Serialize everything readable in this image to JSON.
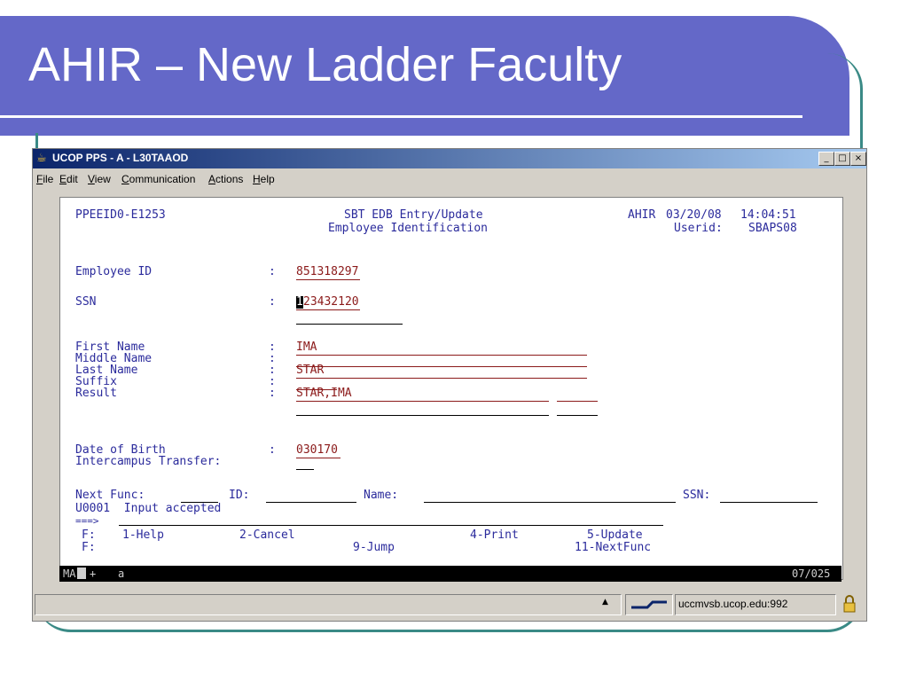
{
  "slide": {
    "title": "AHIR – New Ladder Faculty"
  },
  "window": {
    "title": "UCOP PPS - A - L30TAAOD",
    "controls": {
      "minimize": "_",
      "maximize": "□",
      "close": "×"
    },
    "menu": [
      "File",
      "Edit",
      "View",
      "Communication",
      "Actions",
      "Help"
    ]
  },
  "screen": {
    "program_id": "PPEEID0-E1253",
    "heading1": "SBT EDB Entry/Update",
    "heading2": "Employee Identification",
    "system": "AHIR",
    "date": "03/20/08",
    "time": "14:04:51",
    "userid_label": "Userid:",
    "userid": "SBAPS08",
    "fields": {
      "employee_id_label": "Employee ID",
      "employee_id": "851318297",
      "ssn_label": "SSN",
      "ssn_first": "1",
      "ssn_rest": "23432120",
      "first_name_label": "First Name",
      "first_name": "IMA",
      "middle_name_label": "Middle Name",
      "last_name_label": "Last Name",
      "last_name": "STAR",
      "suffix_label": "Suffix",
      "result_label": "Result",
      "result": "STAR,IMA",
      "dob_label": "Date of Birth",
      "dob": "030170",
      "intercampus_label": "Intercampus Transfer:",
      "colon": ":"
    },
    "nav": {
      "next_func": "Next Func:",
      "id": "ID:",
      "name": "Name:",
      "ssn": "SSN:"
    },
    "message": "U0001  Input accepted",
    "prompt": "===>",
    "fkeys_row1": {
      "label": "F:",
      "f1": "1-Help",
      "f2": "2-Cancel",
      "f4": "4-Print",
      "f5": "5-Update"
    },
    "fkeys_row2": {
      "label": "F:",
      "f9": "9-Jump",
      "f11": "11-NextFunc"
    }
  },
  "status": {
    "mode": "MA",
    "plus": "+",
    "indicator": "a",
    "cursor_pos": "07/025"
  },
  "connection": {
    "host": "uccmvsb.ucop.edu:992"
  },
  "icons": {
    "app": "java-cup-icon",
    "connect": "connection-icon",
    "lock": "lock-icon",
    "scroll": "scroll-up-icon"
  }
}
